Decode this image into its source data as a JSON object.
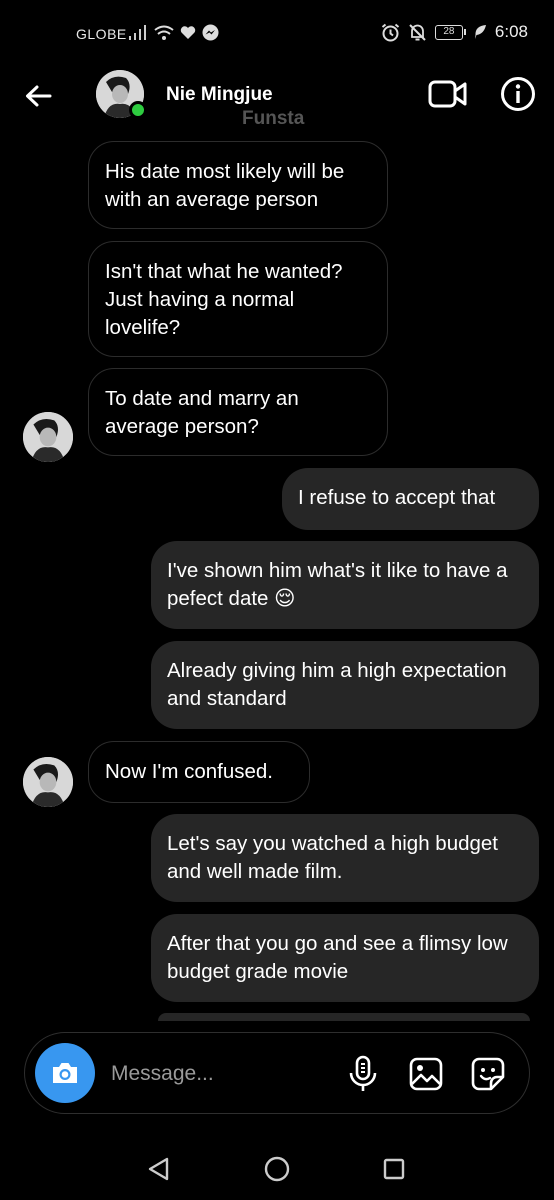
{
  "status_bar": {
    "carrier": "GLOBE",
    "battery": "28",
    "time": "6:08"
  },
  "header": {
    "name": "Nie Mingjue",
    "subtitle": "Funsta",
    "icons": [
      "back-arrow-icon",
      "video-call-icon",
      "info-icon"
    ]
  },
  "messages": [
    {
      "dir": "in",
      "text": "His date most likely will be with an average person"
    },
    {
      "dir": "in",
      "text": "Isn't that what he wanted? Just having a normal lovelife?"
    },
    {
      "dir": "in",
      "text": "To date and marry an average person?"
    },
    {
      "dir": "out",
      "text": "I refuse to accept that"
    },
    {
      "dir": "out",
      "text": "I've shown him what's it like to have a pefect date 😌"
    },
    {
      "dir": "out",
      "text": "Already giving him a high expectation and standard"
    },
    {
      "dir": "in",
      "text": "Now I'm confused."
    },
    {
      "dir": "out",
      "text": "Let's say you watched a high budget and well made film."
    },
    {
      "dir": "out",
      "text": "After that you go and see a flimsy low budget grade movie"
    }
  ],
  "composer": {
    "placeholder": "Message...",
    "icons": [
      "camera-icon",
      "microphone-icon",
      "gallery-icon",
      "sticker-icon"
    ]
  },
  "colors": {
    "background": "#000000",
    "outgoing_bubble": "#262626",
    "accent": "#3897f0",
    "online": "#2ecc40"
  }
}
